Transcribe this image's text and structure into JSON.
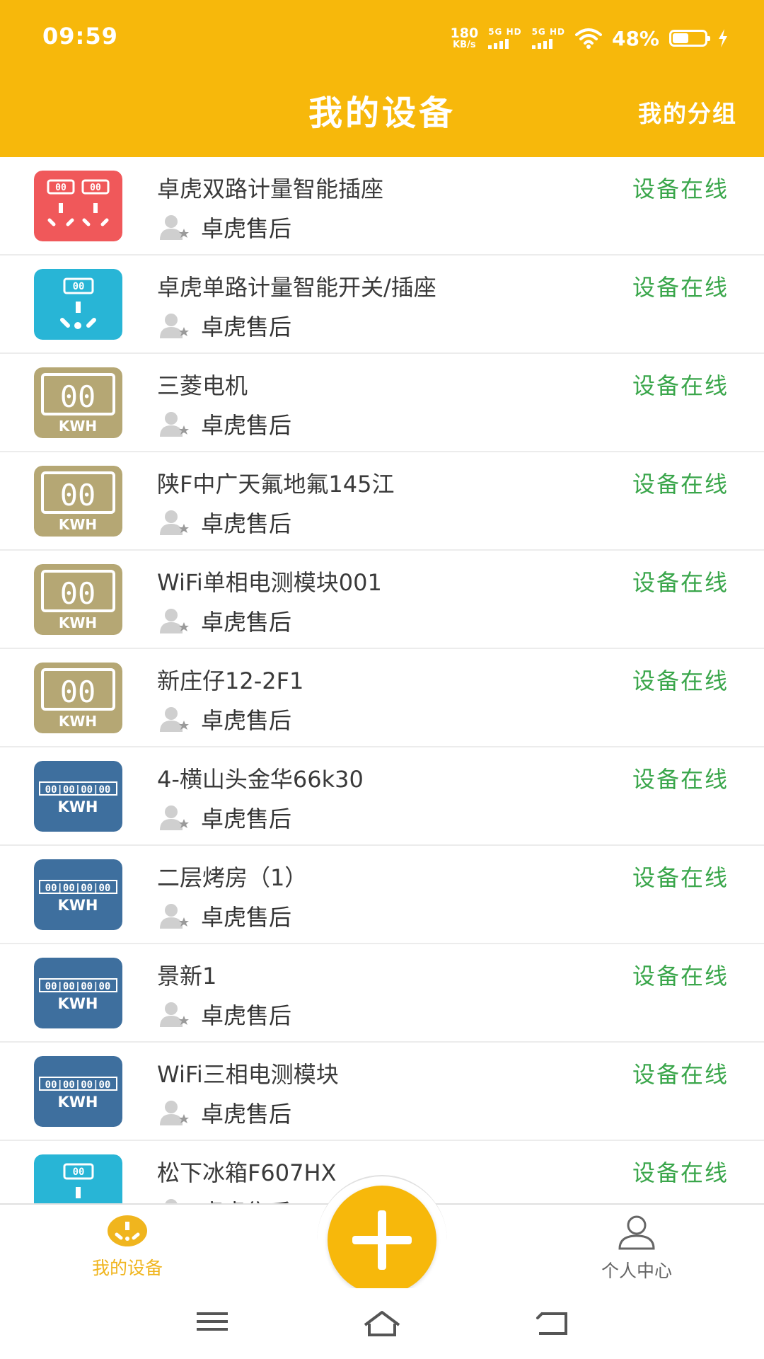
{
  "status_bar": {
    "time": "09:59",
    "net_speed_value": "180",
    "net_speed_unit": "KB/s",
    "sim1": "5G HD",
    "sim2": "5G HD",
    "battery": "48%"
  },
  "header": {
    "title": "我的设备",
    "right_action": "我的分组"
  },
  "colors": {
    "header": "#f7b80b",
    "online": "#3aa64b",
    "tab_active": "#f0b51e",
    "tab_inactive": "#666666"
  },
  "devices": [
    {
      "name": "卓虎双路计量智能插座",
      "owner": "卓虎售后",
      "status": "设备在线",
      "icon": "dual-socket-icon"
    },
    {
      "name": "卓虎单路计量智能开关/插座",
      "owner": "卓虎售后",
      "status": "设备在线",
      "icon": "single-socket-icon"
    },
    {
      "name": "三菱电机",
      "owner": "卓虎售后",
      "status": "设备在线",
      "icon": "kwh-meter-icon"
    },
    {
      "name": "陕F中广天氟地氟145江",
      "owner": "卓虎售后",
      "status": "设备在线",
      "icon": "kwh-meter-icon"
    },
    {
      "name": "WiFi单相电测模块001",
      "owner": "卓虎售后",
      "status": "设备在线",
      "icon": "kwh-meter-icon"
    },
    {
      "name": "新庄仔12-2F1",
      "owner": "卓虎售后",
      "status": "设备在线",
      "icon": "kwh-meter-icon"
    },
    {
      "name": "4-横山头金华66k30",
      "owner": "卓虎售后",
      "status": "设备在线",
      "icon": "three-phase-meter-icon"
    },
    {
      "name": "二层烤房（1）",
      "owner": "卓虎售后",
      "status": "设备在线",
      "icon": "three-phase-meter-icon"
    },
    {
      "name": "景新1",
      "owner": "卓虎售后",
      "status": "设备在线",
      "icon": "three-phase-meter-icon"
    },
    {
      "name": "WiFi三相电测模块",
      "owner": "卓虎售后",
      "status": "设备在线",
      "icon": "three-phase-meter-icon"
    },
    {
      "name": "松下冰箱F607HX",
      "owner": "卓虎售后",
      "status": "设备在线",
      "icon": "single-socket-icon"
    }
  ],
  "tabs": {
    "devices": "我的设备",
    "profile": "个人中心"
  },
  "icons": {
    "add": "plus-icon",
    "menu": "menu-icon",
    "home": "home-icon",
    "back": "back-icon"
  }
}
